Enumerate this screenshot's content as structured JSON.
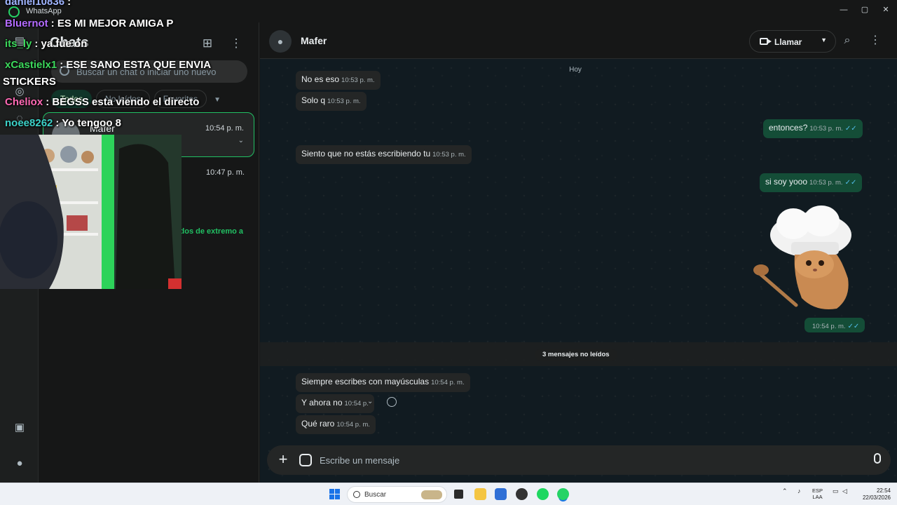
{
  "window": {
    "app_name": "WhatsApp",
    "controls": [
      "—",
      "▢",
      "✕"
    ]
  },
  "sidebar": {
    "title": "Chats",
    "search_placeholder": "Buscar un chat o iniciar uno nuevo",
    "filters": [
      {
        "label": "Todos",
        "active": true
      },
      {
        "label": "No leídos",
        "active": false
      },
      {
        "label": "Favoritos",
        "active": false
      }
    ],
    "chats": [
      {
        "name": "Mafer",
        "time": "10:54 p. m.",
        "preview": "",
        "selected": true
      },
      {
        "name": "",
        "time": "10:47 p. m.",
        "preview": "",
        "selected": false
      },
      {
        "name": "",
        "time": "",
        "preview": "ados de extremo a",
        "selected": false
      }
    ]
  },
  "conversation": {
    "contact_name": "Mafer",
    "call_label": "Llamar",
    "day_label": "Hoy",
    "unread_label": "3 mensajes no leídos",
    "composer_placeholder": "Escribe un mensaje",
    "messages": [
      {
        "dir": "in",
        "text": "No es eso",
        "time": "10:53 p. m."
      },
      {
        "dir": "in",
        "text": "Solo q",
        "time": "10:53 p. m."
      },
      {
        "dir": "out",
        "text": "entonces?",
        "time": "10:53 p. m.",
        "ticks": "✓✓"
      },
      {
        "dir": "in",
        "text": "Siento que no estás escribiendo tu",
        "time": "10:53 p. m."
      },
      {
        "dir": "out",
        "text": "si soy yooo",
        "time": "10:53 p. m.",
        "ticks": "✓✓"
      },
      {
        "dir": "out",
        "text": "",
        "time": "10:54 p. m.",
        "ticks": "✓✓",
        "sticker": true
      },
      {
        "dir": "in",
        "text": "Siempre escribes con mayúsculas",
        "time": "10:54 p. m."
      },
      {
        "dir": "in",
        "text": "Y ahora no",
        "time": "10:54 p."
      },
      {
        "dir": "in",
        "text": "Qué raro",
        "time": "10:54 p. m."
      }
    ]
  },
  "stream_overlay": [
    {
      "user": "daniel10836",
      "user_color": "#9fb4ff",
      "text": ":"
    },
    {
      "user": "Bluernot",
      "user_color": "#b36bff",
      "text": ": ES MI MEJOR AMIGA P"
    },
    {
      "user": "its_ly",
      "user_color": "#3cd95c",
      "text": ": ya fue on"
    },
    {
      "user": "xCastielx1",
      "user_color": "#3cd95c",
      "text": ": ESE SANO ESTA QUE ENVIA"
    },
    {
      "user": "",
      "user_color": "#ffffff",
      "text": "STICKERS"
    },
    {
      "user": "Cheliox",
      "user_color": "#ff69b4",
      "text": ": BEGSS esta viendo el directo"
    },
    {
      "user": "noee8262",
      "user_color": "#3cd1c8",
      "text": ": Yo tengoo 8"
    }
  ],
  "taskbar": {
    "search_label": "Buscar",
    "lang_line1": "ESP",
    "lang_line2": "LAA",
    "time": "22:54",
    "date": "22/03/2026"
  },
  "colors": {
    "accent": "#21c063",
    "bubble_in": "#242626",
    "bubble_out": "#144d37",
    "read_ticks": "#53bdeb"
  }
}
